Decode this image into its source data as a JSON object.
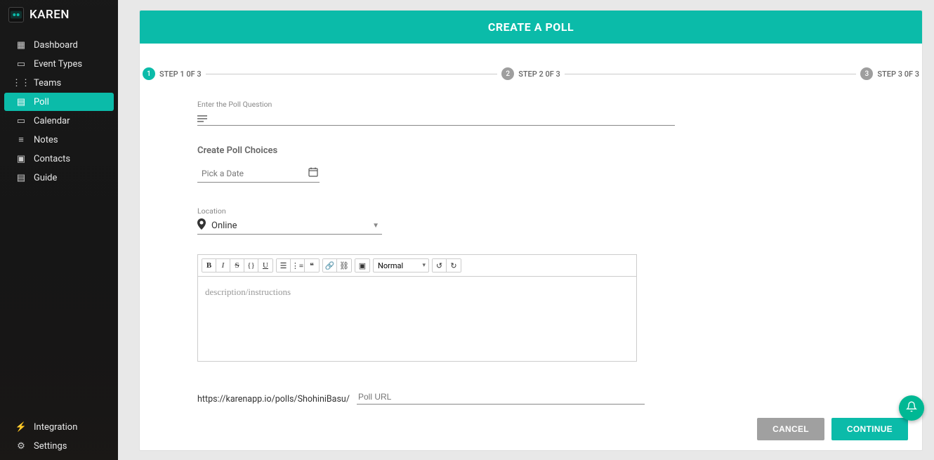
{
  "brand": {
    "name": "KAREN"
  },
  "sidebar": {
    "items": [
      {
        "label": "Dashboard",
        "icon": "grid-icon"
      },
      {
        "label": "Event Types",
        "icon": "calendar-icon"
      },
      {
        "label": "Teams",
        "icon": "people-icon"
      },
      {
        "label": "Poll",
        "icon": "poll-icon"
      },
      {
        "label": "Calendar",
        "icon": "calendar-icon"
      },
      {
        "label": "Notes",
        "icon": "notes-icon"
      },
      {
        "label": "Contacts",
        "icon": "contacts-icon"
      },
      {
        "label": "Guide",
        "icon": "book-icon"
      }
    ],
    "bottom": [
      {
        "label": "Integration",
        "icon": "plug-icon"
      },
      {
        "label": "Settings",
        "icon": "gear-icon"
      }
    ],
    "active_index": 3
  },
  "page": {
    "title": "CREATE A POLL",
    "steps": [
      {
        "num": "1",
        "label": "STEP 1 0F 3"
      },
      {
        "num": "2",
        "label": "STEP 2 0F 3"
      },
      {
        "num": "3",
        "label": "STEP 3 0F 3"
      }
    ],
    "active_step": 0
  },
  "form": {
    "question_label": "Enter the Poll Question",
    "question_value": "",
    "choices_title": "Create Poll Choices",
    "date_placeholder": "Pick a Date",
    "location_label": "Location",
    "location_value": "Online",
    "editor_placeholder": "description/instructions",
    "editor_normal": "Normal",
    "url_prefix": "https://karenapp.io/polls/ShohiniBasu/",
    "url_placeholder": "Poll URL"
  },
  "buttons": {
    "cancel": "CANCEL",
    "continue": "CONTINUE"
  },
  "colors": {
    "accent": "#0bbba9"
  }
}
